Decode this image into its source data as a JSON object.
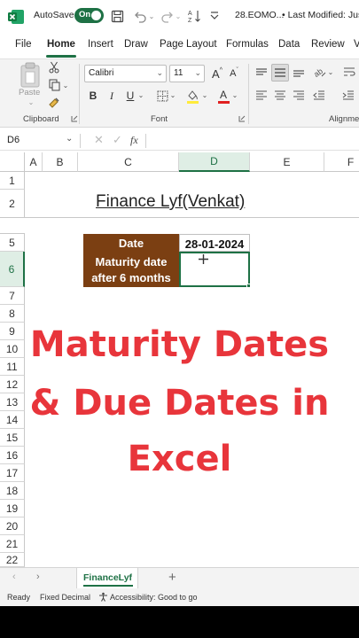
{
  "titlebar": {
    "autosave_label": "AutoSave",
    "toggle_label": "On",
    "filename": "28.EOMO...",
    "last_modified": "• Last Modified: Jus"
  },
  "tabs": [
    "File",
    "Home",
    "Insert",
    "Draw",
    "Page Layout",
    "Formulas",
    "Data",
    "Review",
    "V"
  ],
  "active_tab": "Home",
  "ribbon": {
    "paste_label": "Paste",
    "clipboard_label": "Clipboard",
    "font_name": "Calibri",
    "font_size": "11",
    "font_group_label": "Font",
    "alignment_label": "Alignmer",
    "grow_font": "A",
    "shrink_font": "A",
    "bold": "B",
    "italic": "I",
    "underline": "U"
  },
  "formula_bar": {
    "name_box": "D6",
    "fx": "fx",
    "value": ""
  },
  "columns": [
    "A",
    "B",
    "C",
    "D",
    "E",
    "F"
  ],
  "selected_column": "D",
  "rows": [
    "1",
    "2",
    "5",
    "6",
    "7",
    "8",
    "9",
    "10",
    "11",
    "12",
    "13",
    "14",
    "15",
    "16",
    "17",
    "18",
    "19",
    "20",
    "21",
    "22"
  ],
  "selected_row": "6",
  "sheet": {
    "title": "Finance Lyf(Venkat)",
    "date_label": "Date",
    "date_value": "28-01-2024",
    "maturity_label_line1": "Maturity date",
    "maturity_label_line2": "after 6 months",
    "maturity_value": ""
  },
  "overlay": {
    "line1": "Maturity Dates",
    "line2": "& Due Dates in",
    "line3": "Excel"
  },
  "sheet_tabs": {
    "active": "FinanceLyf",
    "add": "+"
  },
  "status": {
    "ready": "Ready",
    "fixed_decimal": "Fixed Decimal",
    "accessibility": "Accessibility: Good to go"
  },
  "colors": {
    "excel_green": "#1e7145",
    "header_fill": "#7b3f12",
    "overlay_red": "#e8353b"
  }
}
